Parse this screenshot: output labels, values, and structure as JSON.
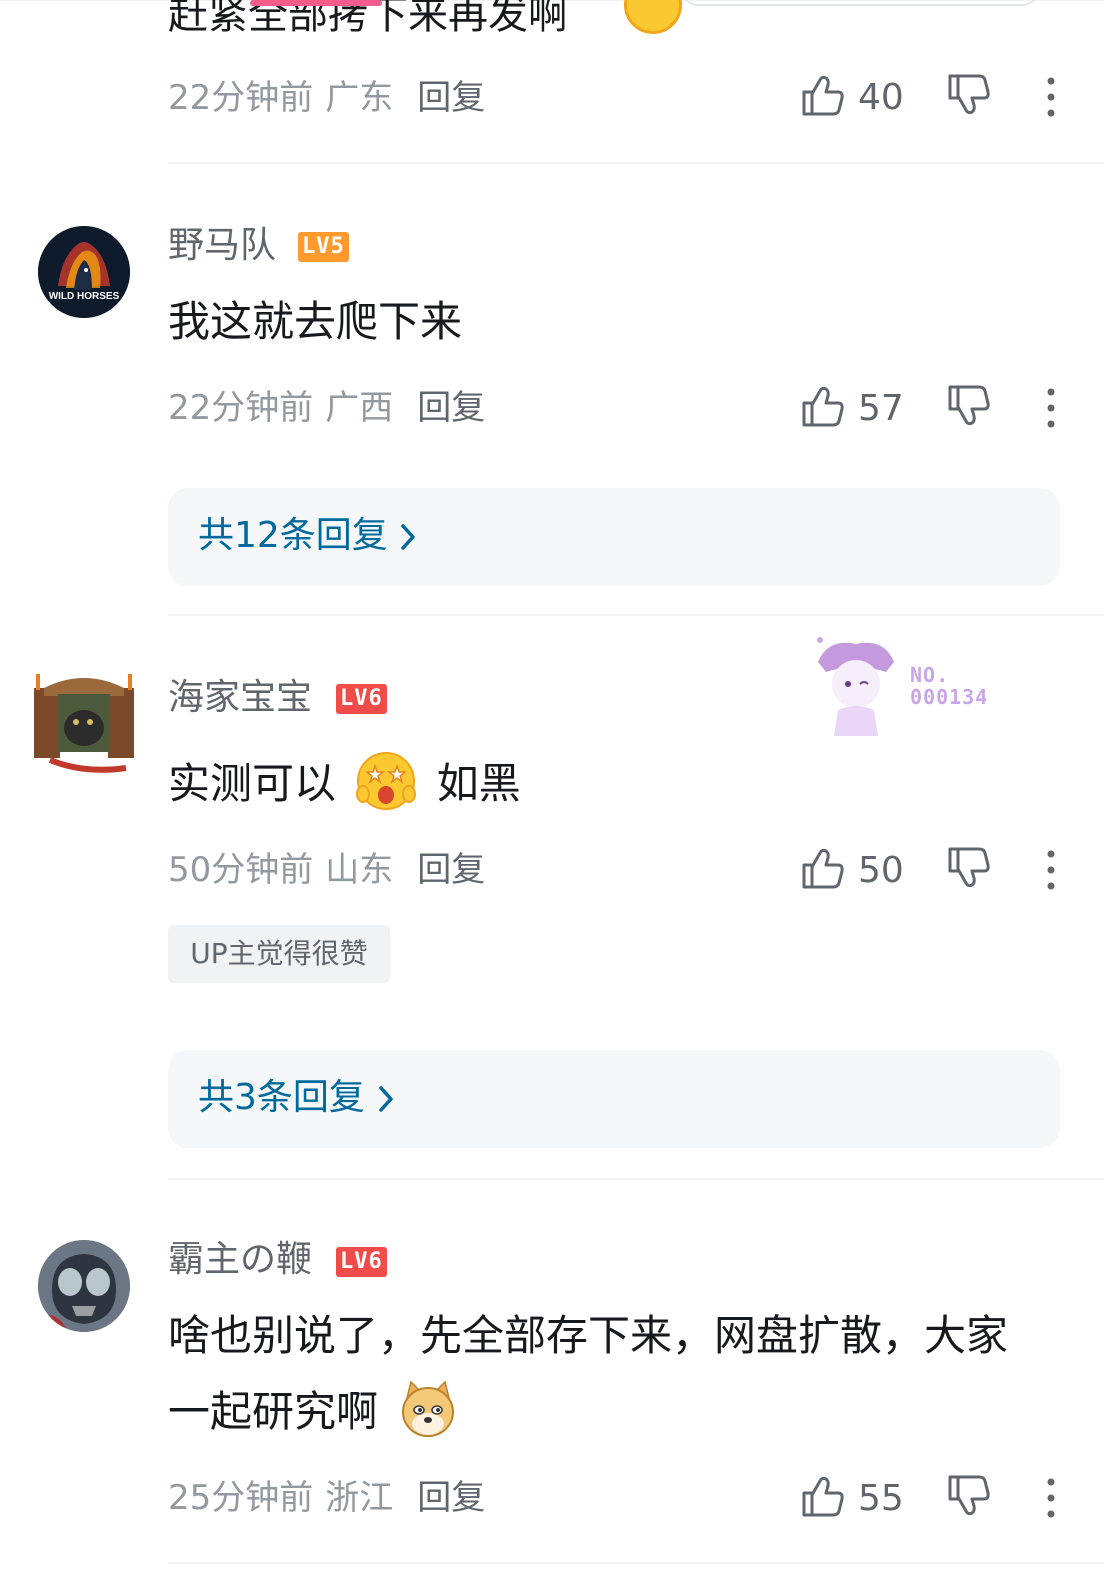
{
  "colors": {
    "accent_pink": "#f25d8e",
    "reply_link": "#00699d",
    "lv5": "#ff9a2e",
    "lv6": "#f04c49",
    "muted_text": "#9499a0"
  },
  "partial_comment": {
    "text": "赶紧全部拷下来再发啊",
    "time": "22分钟前",
    "location": "广东",
    "reply_label": "回复",
    "likes": "40"
  },
  "comments": [
    {
      "username": "野马队",
      "level": "LV5",
      "avatar_text": "WILD HORSES",
      "content": "我这就去爬下来",
      "time": "22分钟前",
      "location": "广西",
      "reply_label": "回复",
      "likes": "57",
      "replies_label": "共12条回复"
    },
    {
      "username": "海家宝宝",
      "level": "LV6",
      "content_before": "实测可以",
      "content_after": "如黑",
      "emoji": "star-eyes-emoji",
      "badge_no_label": "NO.",
      "badge_no_value": "000134",
      "time": "50分钟前",
      "location": "山东",
      "reply_label": "回复",
      "likes": "50",
      "up_tag": "UP主觉得很赞",
      "replies_label": "共3条回复"
    },
    {
      "username": "霸主の鞭",
      "level": "LV6",
      "content_line1": "啥也别说了，先全部存下来，网盘扩散，大家",
      "content_line2": "一起研究啊",
      "emoji": "doge-emoji",
      "time": "25分钟前",
      "location": "浙江",
      "reply_label": "回复",
      "likes": "55"
    }
  ]
}
